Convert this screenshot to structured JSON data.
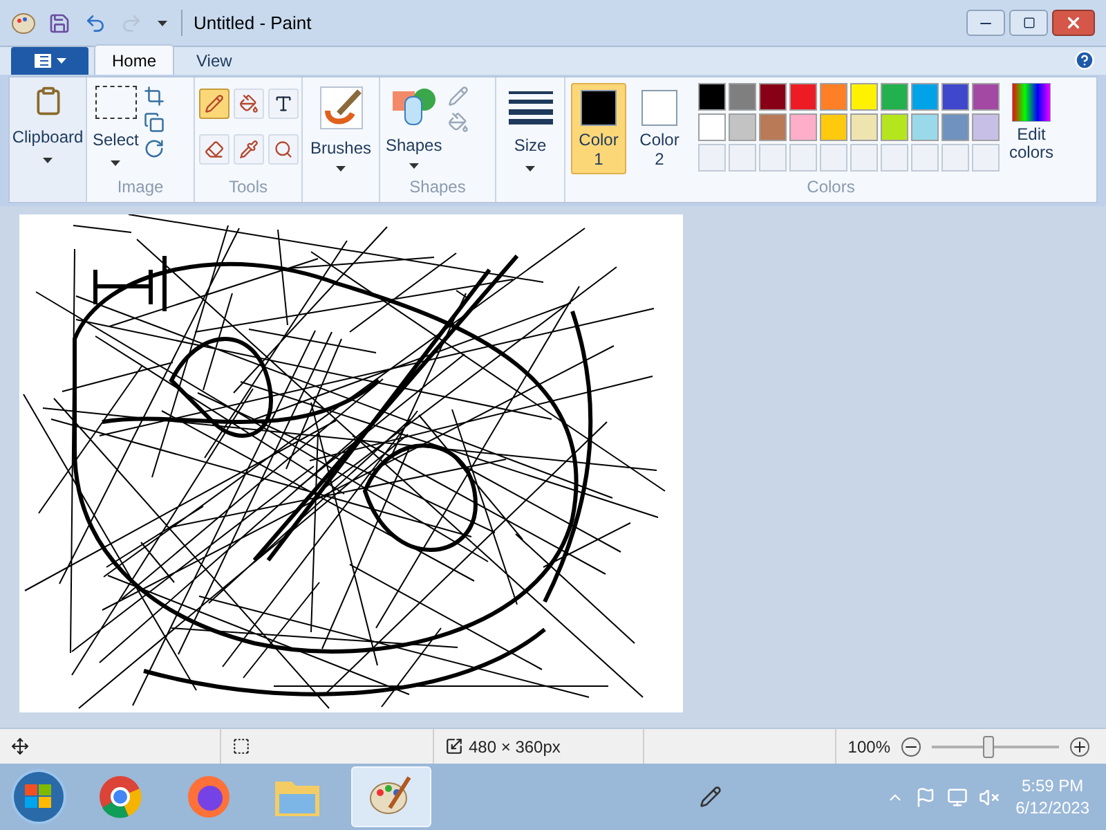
{
  "window": {
    "title": "Untitled - Paint"
  },
  "tabs": [
    {
      "label": "Home",
      "selected": true
    },
    {
      "label": "View",
      "selected": false
    }
  ],
  "ribbon": {
    "clipboard": {
      "label": "Clipboard"
    },
    "image": {
      "select": "Select",
      "label": "Image"
    },
    "tools": {
      "label": "Tools",
      "items": [
        {
          "kind": "pencil",
          "selected": true
        },
        {
          "kind": "fill",
          "selected": false
        },
        {
          "kind": "text",
          "selected": false
        },
        {
          "kind": "eraser",
          "selected": false
        },
        {
          "kind": "picker",
          "selected": false
        },
        {
          "kind": "magnifier",
          "selected": false
        }
      ]
    },
    "brushes": {
      "label": "Brushes"
    },
    "shapes": {
      "button": "Shapes",
      "label": "Shapes"
    },
    "size": {
      "label": "Size"
    },
    "colors": {
      "label": "Colors",
      "slots": [
        {
          "label": "Color 1",
          "color": "#000000",
          "selected": true
        },
        {
          "label": "Color 2",
          "color": "#ffffff",
          "selected": false
        }
      ],
      "palette": [
        {
          "color": "#000000"
        },
        {
          "color": "#7f7f7f"
        },
        {
          "color": "#880015"
        },
        {
          "color": "#ed1c24"
        },
        {
          "color": "#ff7f27"
        },
        {
          "color": "#fff200"
        },
        {
          "color": "#22b14c"
        },
        {
          "color": "#00a2e8"
        },
        {
          "color": "#3f48cc"
        },
        {
          "color": "#a349a4"
        },
        {
          "color": "#ffffff"
        },
        {
          "color": "#c3c3c3"
        },
        {
          "color": "#b97a57"
        },
        {
          "color": "#ffaec9"
        },
        {
          "color": "#ffc90e"
        },
        {
          "color": "#efe4b0"
        },
        {
          "color": "#b5e61d"
        },
        {
          "color": "#99d9ea"
        },
        {
          "color": "#7092be"
        },
        {
          "color": "#c8bfe7"
        }
      ],
      "edit": "Edit colors"
    }
  },
  "status_bar": {
    "dimensions": "480 × 360px",
    "zoom": "100%",
    "zoom_slider": {
      "level": 0.45
    }
  },
  "taskbar": {
    "apps": [
      {
        "kind": "chrome",
        "selected": false
      },
      {
        "kind": "firefox",
        "selected": false
      },
      {
        "kind": "explorer",
        "selected": false
      },
      {
        "kind": "paint",
        "selected": true
      }
    ],
    "time": "5:59 PM",
    "date": "6/12/2023"
  }
}
